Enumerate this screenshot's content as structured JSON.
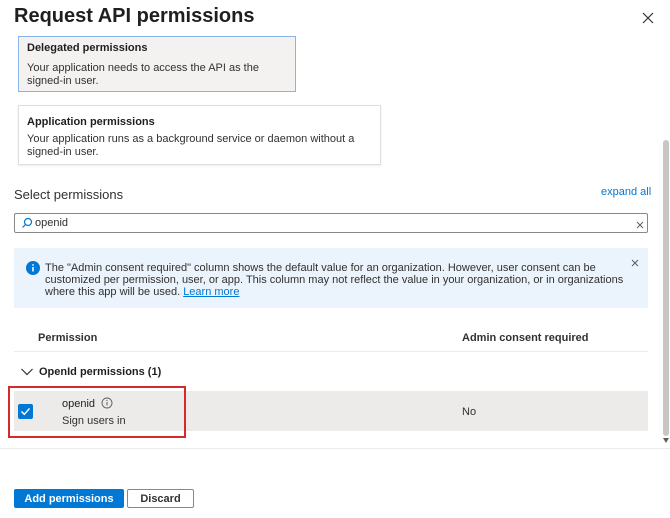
{
  "panel": {
    "title": "Request API permissions"
  },
  "permission_types": {
    "delegated": {
      "title": "Delegated permissions",
      "description_line1": "Your application needs to access the API as the",
      "description_line2": "signed-in user."
    },
    "application": {
      "title": "Application permissions",
      "description_line1": "Your application runs as a background service or daemon without a",
      "description_line2": "signed-in user."
    }
  },
  "select": {
    "label": "Select permissions",
    "expand_link": "expand all"
  },
  "search": {
    "value": "openid"
  },
  "info": {
    "text": "The \"Admin consent required\" column shows the default value for an organization. However, user consent can be customized per permission, user, or app. This column may not reflect the value in your organization, or in organizations where this app will be used. ",
    "link": "Learn more"
  },
  "table": {
    "headers": {
      "permission": "Permission",
      "admin_consent": "Admin consent required"
    },
    "group": {
      "label": "OpenId permissions (1)"
    },
    "rows": [
      {
        "name": "openid",
        "description": "Sign users in",
        "admin_consent": "No",
        "checked": true
      }
    ]
  },
  "footer": {
    "primary": "Add permissions",
    "secondary": "Discard"
  },
  "colors": {
    "accent": "#0078d4",
    "highlight": "#d42a2a",
    "info_bg": "#ebf3fc"
  }
}
